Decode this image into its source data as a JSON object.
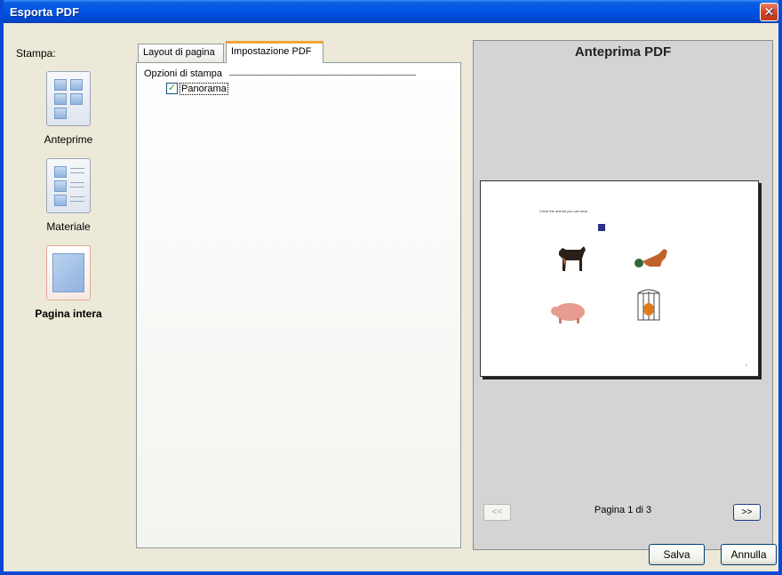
{
  "window": {
    "title": "Esporta PDF"
  },
  "sidebar": {
    "heading": "Stampa:",
    "options": [
      {
        "label": "Anteprime",
        "icon": "thumbnails-icon"
      },
      {
        "label": "Materiale",
        "icon": "handouts-icon"
      },
      {
        "label": "Pagina intera",
        "icon": "full-page-icon",
        "selected": true
      }
    ]
  },
  "tabs": [
    {
      "label": "Layout di pagina"
    },
    {
      "label": "Impostazione PDF",
      "active": true
    }
  ],
  "print_options": {
    "group_title": "Opzioni di stampa",
    "panorama": {
      "label": "Panorama",
      "checked": true
    }
  },
  "preview": {
    "title": "Anteprima PDF",
    "page_text": "Circle the animal you can hear",
    "page_number": "1",
    "prev_label": "<<",
    "next_label": ">>",
    "pagination": "Pagina 1 di 3"
  },
  "buttons": {
    "save": "Salva",
    "cancel": "Annulla"
  },
  "colors": {
    "titlebar": "#0054e3",
    "tab_accent": "#f2a53a",
    "check": "#21a121"
  }
}
